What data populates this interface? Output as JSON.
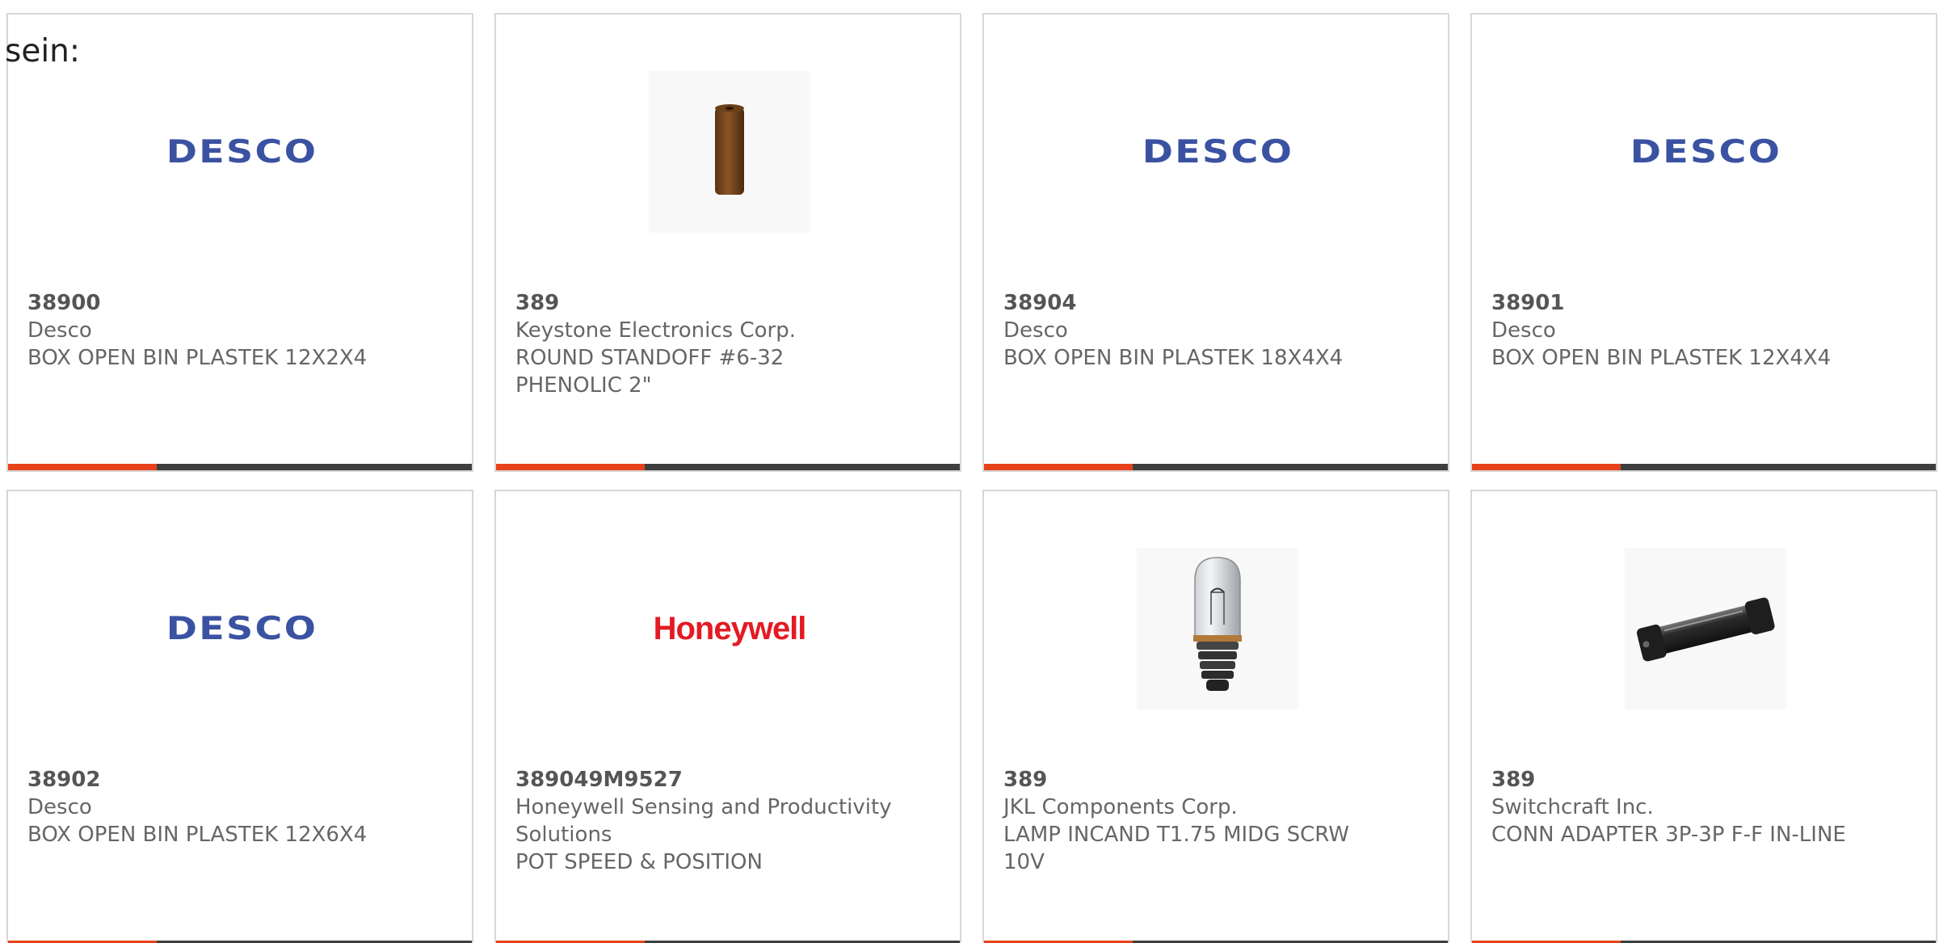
{
  "intro_text": "sein:",
  "colors": {
    "accent": "#e8421a",
    "bar": "#3e3e3e",
    "desco_blue": "#3a52a1",
    "honeywell_red": "#e31b23"
  },
  "cards": [
    {
      "part_number": "38900",
      "manufacturer": "Desco",
      "description": "BOX OPEN BIN PLASTEK 12X2X4",
      "image": "desco-logo",
      "logo_text": "DESCO"
    },
    {
      "part_number": "389",
      "manufacturer": "Keystone Electronics Corp.",
      "description": "ROUND STANDOFF #6-32 PHENOLIC 2\"",
      "image": "standoff-photo"
    },
    {
      "part_number": "38904",
      "manufacturer": "Desco",
      "description": "BOX OPEN BIN PLASTEK 18X4X4",
      "image": "desco-logo",
      "logo_text": "DESCO"
    },
    {
      "part_number": "38901",
      "manufacturer": "Desco",
      "description": "BOX OPEN BIN PLASTEK 12X4X4",
      "image": "desco-logo",
      "logo_text": "DESCO"
    },
    {
      "part_number": "38902",
      "manufacturer": "Desco",
      "description": "BOX OPEN BIN PLASTEK 12X6X4",
      "image": "desco-logo",
      "logo_text": "DESCO"
    },
    {
      "part_number": "389049M9527",
      "manufacturer": "Honeywell Sensing and Productivity Solutions",
      "description": "POT SPEED & POSITION",
      "image": "honeywell-logo",
      "logo_text": "Honeywell"
    },
    {
      "part_number": "389",
      "manufacturer": "JKL Components Corp.",
      "description": "LAMP INCAND T1.75 MIDG SCRW 10V",
      "image": "lamp-photo"
    },
    {
      "part_number": "389",
      "manufacturer": "Switchcraft Inc.",
      "description": "CONN ADAPTER 3P-3P F-F IN-LINE",
      "image": "adapter-photo"
    }
  ]
}
